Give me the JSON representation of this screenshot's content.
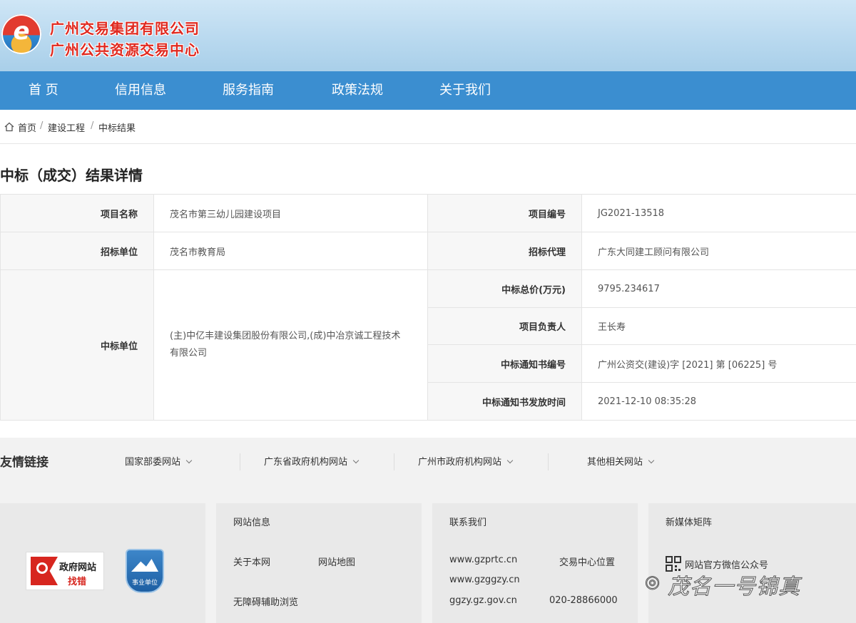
{
  "header": {
    "org_name_1": "广州交易集团有限公司",
    "org_name_2": "广州公共资源交易中心",
    "logo_letter": "e"
  },
  "nav": [
    "首 页",
    "信用信息",
    "服务指南",
    "政策法规",
    "关于我们"
  ],
  "breadcrumb": [
    "首页",
    "建设工程",
    "中标结果"
  ],
  "page_title": "中标（成交）结果详情",
  "details": {
    "project_name_label": "项目名称",
    "project_name": "茂名市第三幼儿园建设项目",
    "project_no_label": "项目编号",
    "project_no": "JG2021-13518",
    "tenderer_label": "招标单位",
    "tenderer": "茂名市教育局",
    "agent_label": "招标代理",
    "agent": "广东大同建工顾问有限公司",
    "winner_label": "中标单位",
    "winner": "(主)中亿丰建设集团股份有限公司,(成)中冶京诚工程技术有限公司",
    "total_price_label": "中标总价(万元)",
    "total_price": "9795.234617",
    "manager_label": "项目负责人",
    "manager": "王长寿",
    "notice_no_label": "中标通知书编号",
    "notice_no": "广州公资交(建设)字 [2021] 第 [06225] 号",
    "notice_time_label": "中标通知书发放时间",
    "notice_time": "2021-12-10 08:35:28"
  },
  "friendly_links": {
    "title": "友情链接",
    "items": [
      "国家部委网站",
      "广东省政府机构网站",
      "广州市政府机构网站",
      "其他相关网站"
    ]
  },
  "footer": {
    "gov_badge_line1": "政府网站",
    "gov_badge_line2": "找错",
    "unit_badge": "事业单位",
    "site_info": {
      "title": "网站信息",
      "about": "关于本网",
      "sitemap": "网站地图",
      "accessibility": "无障碍辅助浏览"
    },
    "contact": {
      "title": "联系我们",
      "site1": "www.gzprtc.cn",
      "location": "交易中心位置",
      "site2": "www.gzggzy.cn",
      "site3": "ggzy.gz.gov.cn",
      "phone": "020-28866000"
    },
    "media": {
      "title": "新媒体矩阵",
      "wechat": "网站官方微信公众号"
    },
    "watermark": "茂名一号锦真"
  },
  "colors": {
    "nav_bg": "#3b8ed0",
    "brand_red": "#e0291f",
    "header_bg": "#b9d9ef"
  }
}
